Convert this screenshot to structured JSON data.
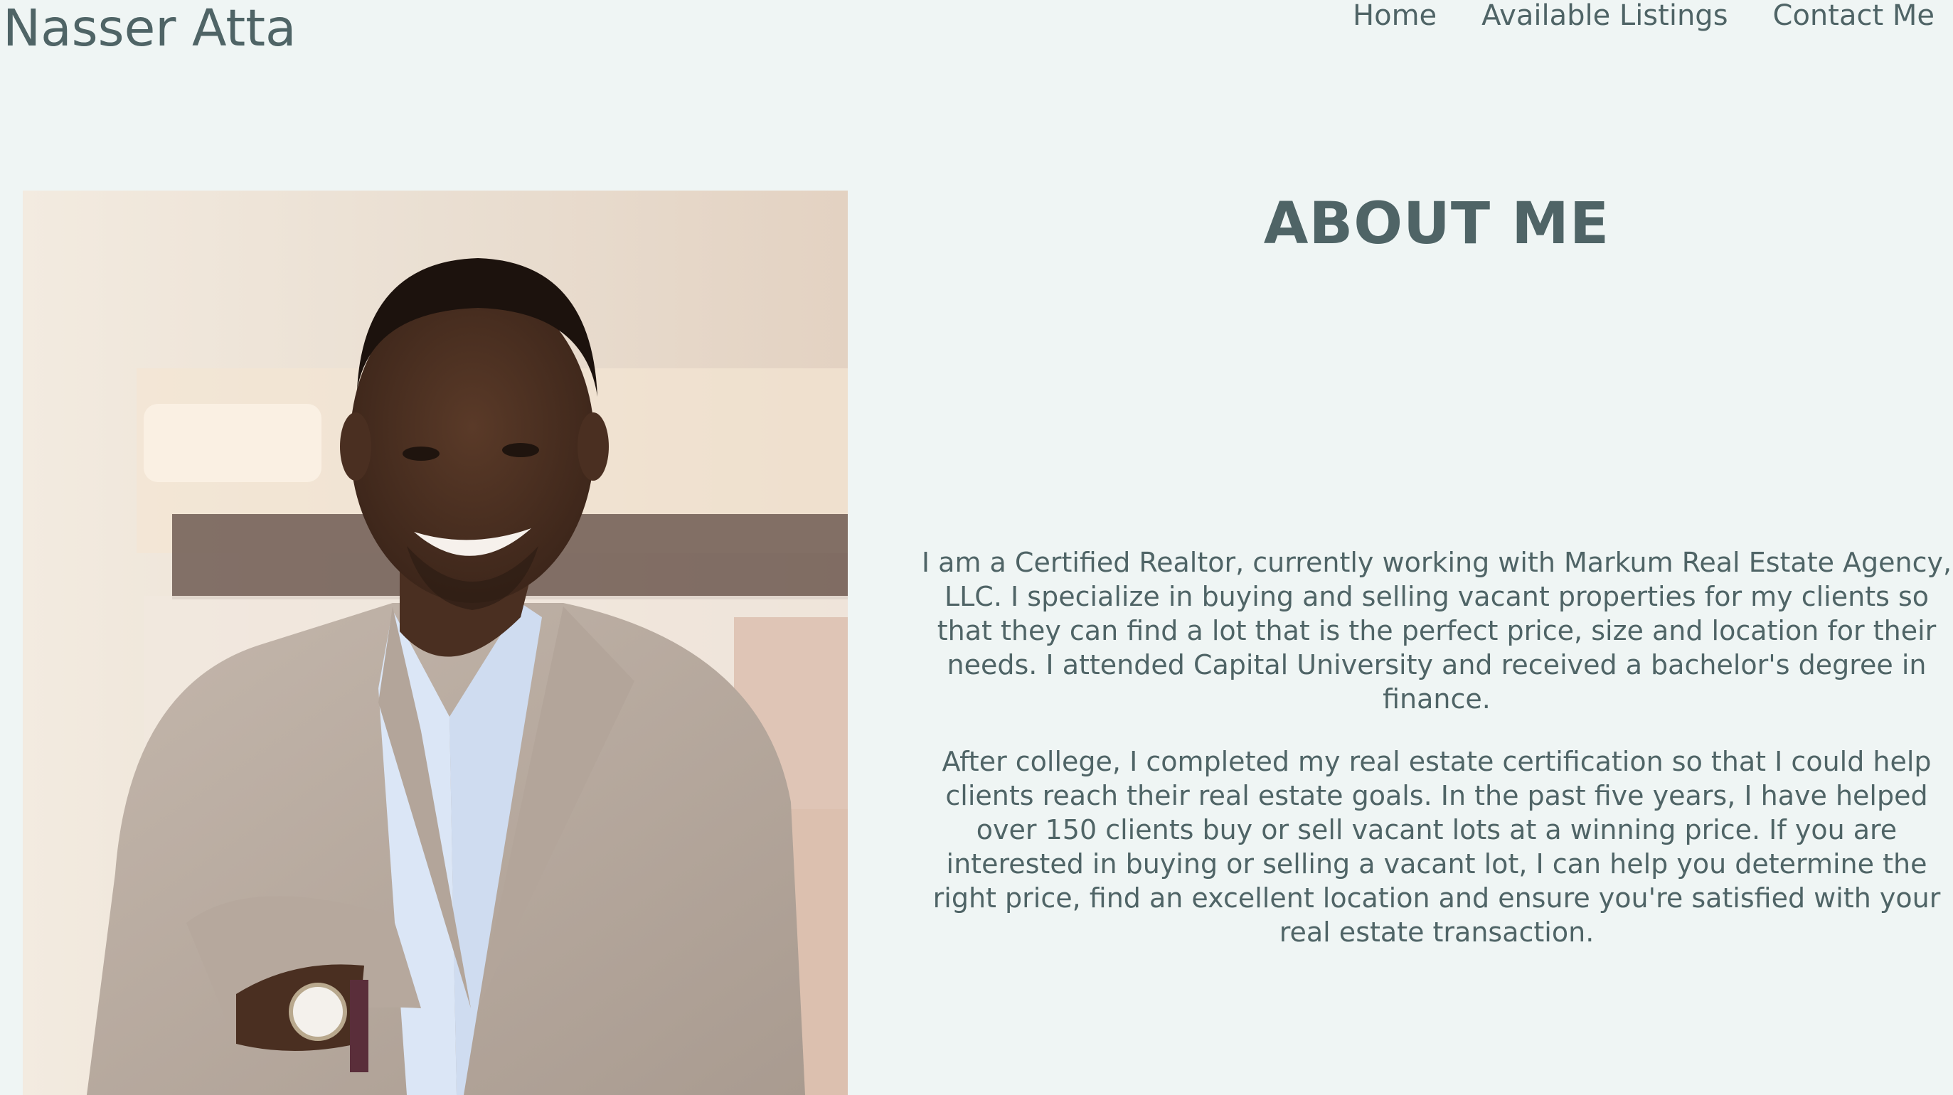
{
  "header": {
    "brand": "Nasser Atta",
    "nav": [
      {
        "label": "Home"
      },
      {
        "label": "Available Listings"
      },
      {
        "label": "Contact Me"
      }
    ]
  },
  "about": {
    "title": "ABOUT ME",
    "paragraphs": [
      "I am a Certified Realtor, currently working with Markum Real Estate Agency, LLC. I specialize in buying and selling vacant properties for my clients so that they can find a lot that is the perfect price, size and location for their needs. I attended Capital University and received a bachelor's degree in finance.",
      "After college, I completed my real estate certification so that I could help clients reach their real estate goals. In the past five years, I have helped over 150 clients buy or sell vacant lots at a winning price. If you are interested in buying or selling a vacant lot, I can help you determine the right price, find an excellent location and ensure you're satisfied with your real estate transaction."
    ]
  },
  "colors": {
    "background": "#eff5f4",
    "text": "#4f6466"
  }
}
